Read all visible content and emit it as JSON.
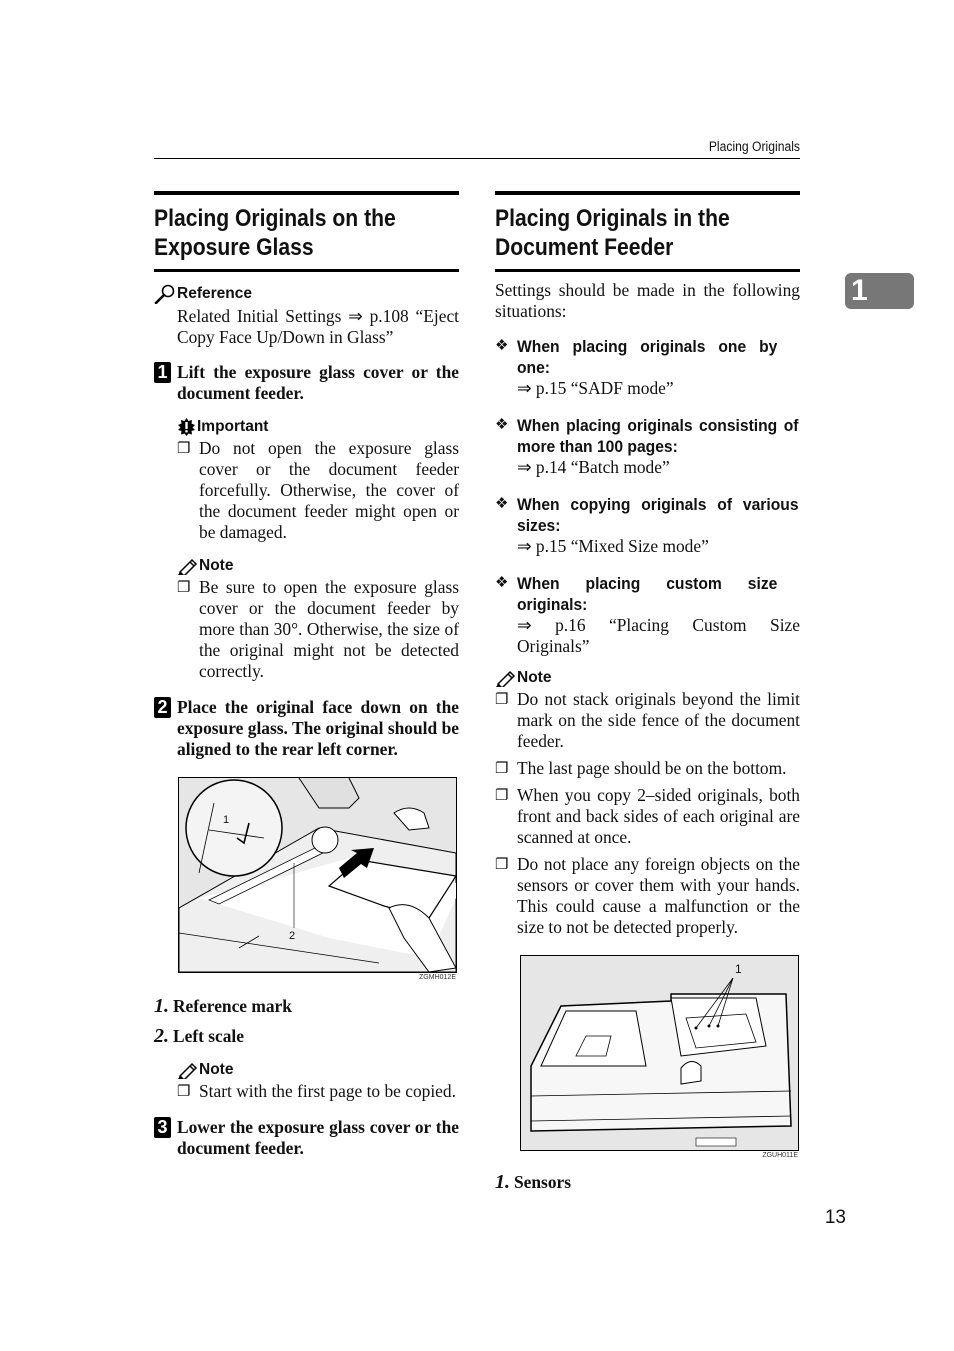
{
  "running_head": "Placing Originals",
  "chapter_tab": "1",
  "page_number": "13",
  "left": {
    "title_line1": "Placing Originals on the",
    "title_line2": "Exposure Glass",
    "reference": {
      "icon": "magnifier-icon",
      "label": "Reference",
      "text": "Related Initial Settings ⇒ p.108 “Eject Copy Face Up/Down in Glass”"
    },
    "steps": [
      {
        "badge": "1",
        "text": "Lift the exposure glass cover or the document feeder.",
        "important": {
          "icon": "important-icon",
          "label": "Important",
          "items": [
            "Do not open the exposure glass cover or the document feeder forcefully. Otherwise, the cover of the document feeder might open or be damaged."
          ]
        },
        "note": {
          "icon": "pencil-icon",
          "label": "Note",
          "items": [
            "Be sure to open the exposure glass cover or the document feeder by more than 30°. Otherwise, the size of the original might not be detected correctly."
          ]
        }
      },
      {
        "badge": "2",
        "text": "Place the original face down on the exposure glass. The original should be aligned to the rear left corner.",
        "figure": {
          "callout_1": "1",
          "callout_2": "2",
          "code": "ZGMH012E"
        },
        "legend": [
          {
            "n": "1.",
            "label": "Reference mark"
          },
          {
            "n": "2.",
            "label": "Left scale"
          }
        ],
        "note": {
          "icon": "pencil-icon",
          "label": "Note",
          "items": [
            "Start with the first page to be copied."
          ]
        }
      },
      {
        "badge": "3",
        "text": "Lower the exposure glass cover or the document feeder."
      }
    ]
  },
  "right": {
    "title_line1": "Placing Originals in the",
    "title_line2": "Document Feeder",
    "intro": "Settings should be made in the following situations:",
    "situations": [
      {
        "heading": "When placing originals one by one:",
        "ref": "⇒ p.15 “SADF mode”"
      },
      {
        "heading": "When placing originals consisting of more than 100 pages:",
        "ref": "⇒ p.14 “Batch mode”"
      },
      {
        "heading": "When copying originals of various sizes:",
        "ref": "⇒ p.15 “Mixed Size mode”"
      },
      {
        "heading": "When placing custom size originals:",
        "ref": "⇒ p.16 “Placing Custom Size Originals”"
      }
    ],
    "note": {
      "icon": "pencil-icon",
      "label": "Note",
      "items": [
        "Do not stack originals beyond the limit mark on the side fence of the document feeder.",
        "The last page should be on the bottom.",
        "When you copy 2–sided originals, both front and back sides of each original are scanned at once.",
        "Do not place any foreign objects on the sensors or cover them with your hands. This could cause a malfunction or the size to not be detected properly."
      ]
    },
    "figure": {
      "callout_1": "1",
      "code": "ZGUH011E"
    },
    "legend": [
      {
        "n": "1.",
        "label": "Sensors"
      }
    ]
  },
  "glyphs": {
    "bullet_diamond": "❖",
    "checkbox": "❐"
  }
}
